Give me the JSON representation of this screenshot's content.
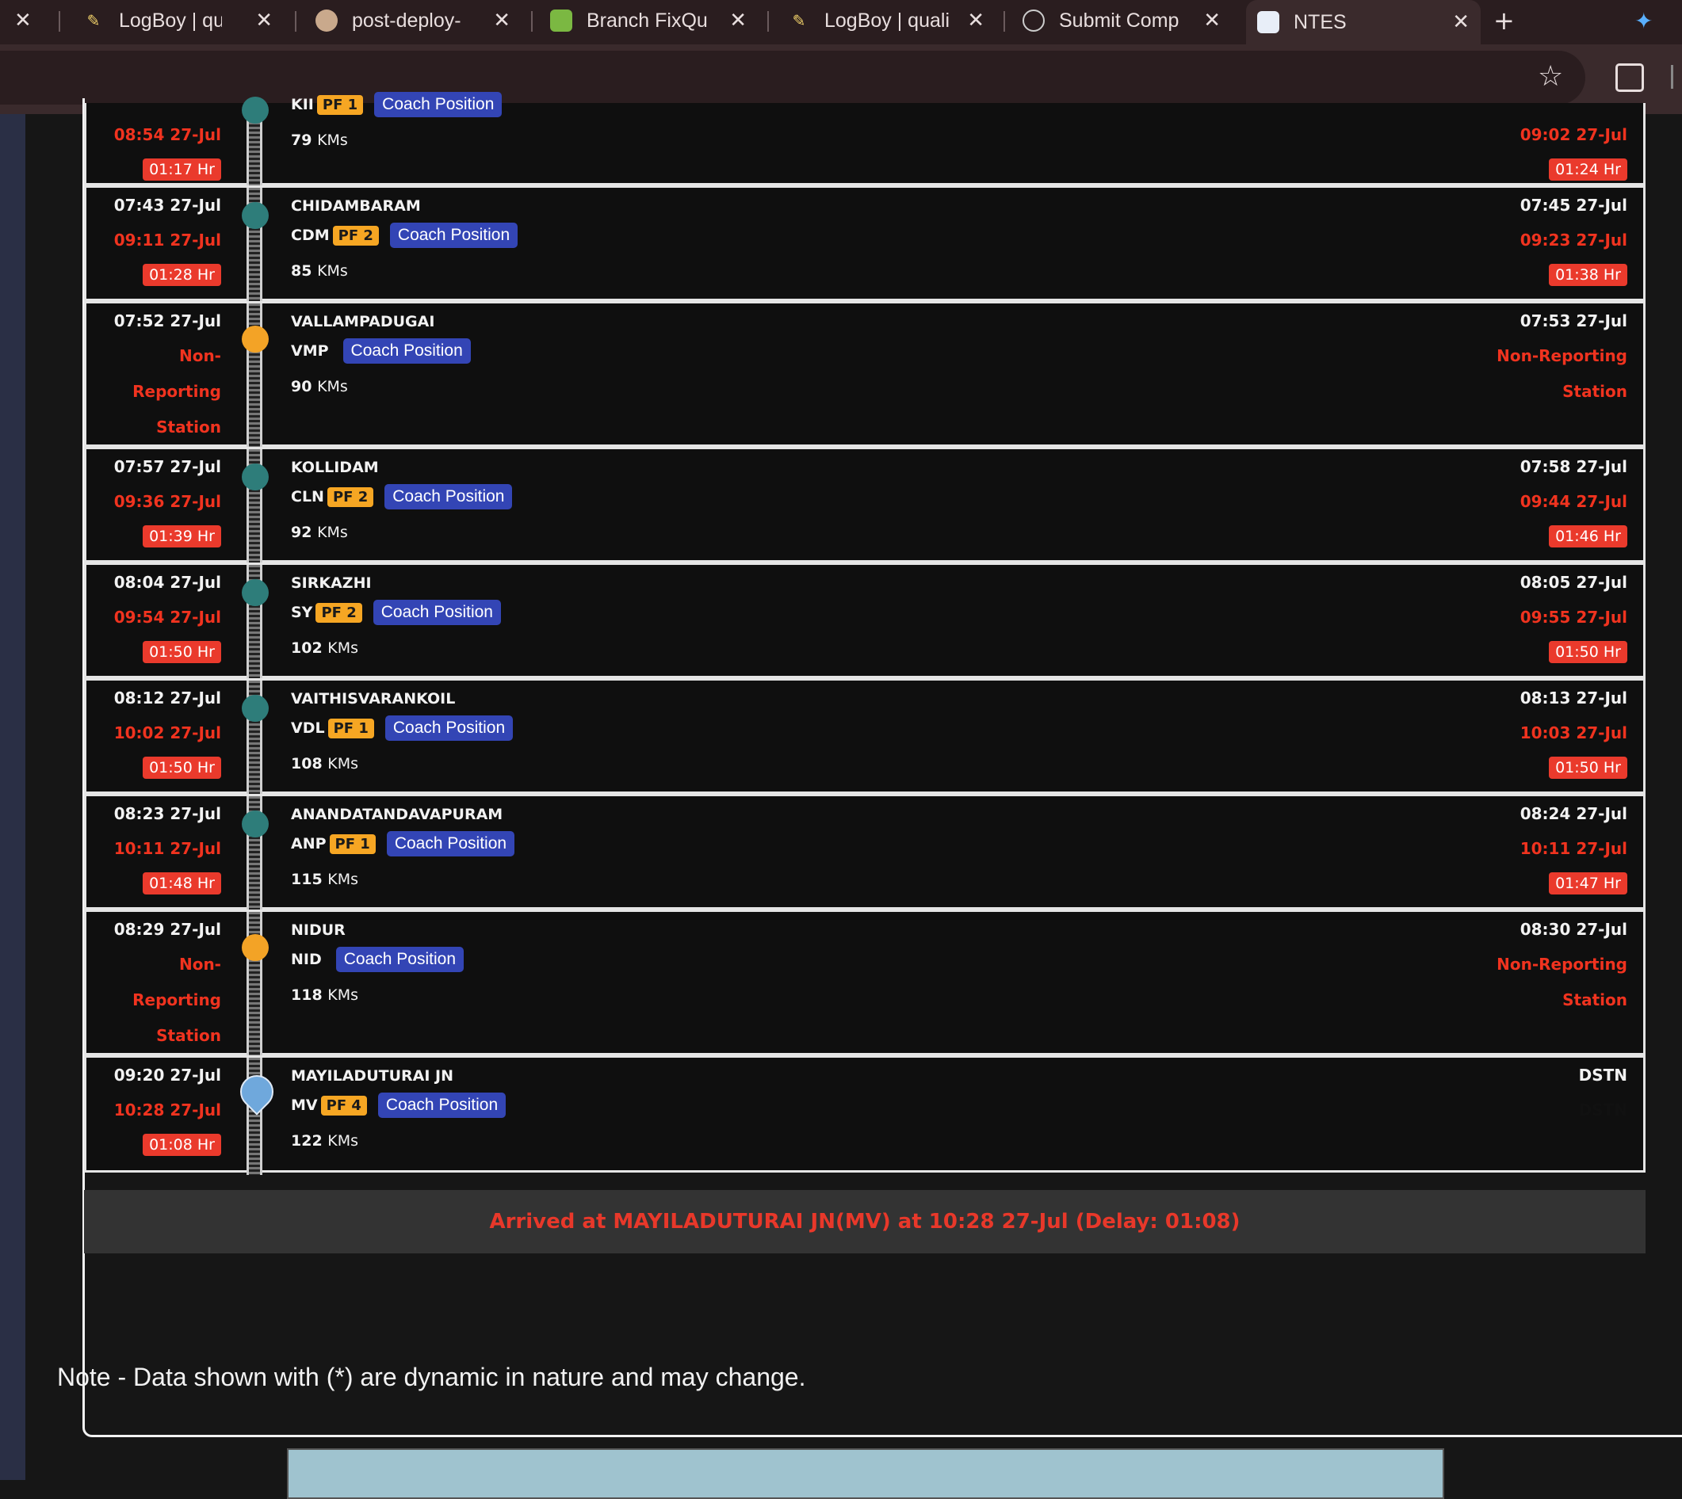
{
  "browser": {
    "tabs": [
      {
        "label": "LogBoy | qual",
        "icon": "pencil-icon"
      },
      {
        "label": "post-deploy-",
        "icon": "avatar-icon"
      },
      {
        "label": "Branch FixQu",
        "icon": "branch-icon"
      },
      {
        "label": "LogBoy | quali",
        "icon": "pencil-icon"
      },
      {
        "label": "Submit Comp",
        "icon": "globe-icon"
      },
      {
        "label": "NTES",
        "icon": "ntes-icon"
      }
    ],
    "new_tab": "+",
    "close_glyph": "✕",
    "star_glyph": "☆"
  },
  "stations": [
    {
      "sched_arr": "",
      "act_arr": "08:54 27-Jul",
      "arr_delay": "01:17 Hr",
      "name": "",
      "code": "KII",
      "pf": "PF 1",
      "km": "79",
      "sched_dep": "",
      "act_dep": "09:02 27-Jul",
      "dep_delay": "01:24 Hr",
      "marker": "teal"
    },
    {
      "sched_arr": "07:43 27-Jul",
      "act_arr": "09:11 27-Jul",
      "arr_delay": "01:28 Hr",
      "name": "CHIDAMBARAM",
      "code": "CDM",
      "pf": "PF 2",
      "km": "85",
      "sched_dep": "07:45 27-Jul",
      "act_dep": "09:23 27-Jul",
      "dep_delay": "01:38 Hr",
      "marker": "teal"
    },
    {
      "sched_arr": "07:52 27-Jul",
      "nr_left": [
        "Non-",
        "Reporting",
        "Station"
      ],
      "name": "VALLAMPADUGAI",
      "code": "VMP",
      "pf": "",
      "km": "90",
      "sched_dep": "07:53 27-Jul",
      "nr_right": [
        "Non-Reporting",
        "Station"
      ],
      "marker": "amber"
    },
    {
      "sched_arr": "07:57 27-Jul",
      "act_arr": "09:36 27-Jul",
      "arr_delay": "01:39 Hr",
      "name": "KOLLIDAM",
      "code": "CLN",
      "pf": "PF 2",
      "km": "92",
      "sched_dep": "07:58 27-Jul",
      "act_dep": "09:44 27-Jul",
      "dep_delay": "01:46 Hr",
      "marker": "teal"
    },
    {
      "sched_arr": "08:04 27-Jul",
      "act_arr": "09:54 27-Jul",
      "arr_delay": "01:50 Hr",
      "name": "SIRKAZHI",
      "code": "SY",
      "pf": "PF 2",
      "km": "102",
      "sched_dep": "08:05 27-Jul",
      "act_dep": "09:55 27-Jul",
      "dep_delay": "01:50 Hr",
      "marker": "teal"
    },
    {
      "sched_arr": "08:12 27-Jul",
      "act_arr": "10:02 27-Jul",
      "arr_delay": "01:50 Hr",
      "name": "VAITHISVARANKOIL",
      "code": "VDL",
      "pf": "PF 1",
      "km": "108",
      "sched_dep": "08:13 27-Jul",
      "act_dep": "10:03 27-Jul",
      "dep_delay": "01:50 Hr",
      "marker": "teal"
    },
    {
      "sched_arr": "08:23 27-Jul",
      "act_arr": "10:11 27-Jul",
      "arr_delay": "01:48 Hr",
      "name": "ANANDATANDAVAPURAM",
      "code": "ANP",
      "pf": "PF 1",
      "km": "115",
      "sched_dep": "08:24 27-Jul",
      "act_dep": "10:11 27-Jul",
      "dep_delay": "01:47 Hr",
      "marker": "teal"
    },
    {
      "sched_arr": "08:29 27-Jul",
      "nr_left": [
        "Non-",
        "Reporting",
        "Station"
      ],
      "name": "NIDUR",
      "code": "NID",
      "pf": "",
      "km": "118",
      "sched_dep": "08:30 27-Jul",
      "nr_right": [
        "Non-Reporting",
        "Station"
      ],
      "marker": "amber"
    },
    {
      "sched_arr": "09:20 27-Jul",
      "act_arr": "10:28 27-Jul",
      "arr_delay": "01:08 Hr",
      "name": "MAYILADUTURAI JN",
      "code": "MV",
      "pf": "PF 4",
      "km": "122",
      "sched_dep": "DSTN",
      "act_dep_hidden": "DSTN",
      "marker": "train"
    }
  ],
  "labels": {
    "coach_position": "Coach Position",
    "kms_suffix": "KMs"
  },
  "arrived_text": "Arrived at MAYILADUTURAI JN(MV) at 10:28 27-Jul (Delay: 01:08)",
  "note": "Note - Data shown with (*) are dynamic in nature and may change."
}
